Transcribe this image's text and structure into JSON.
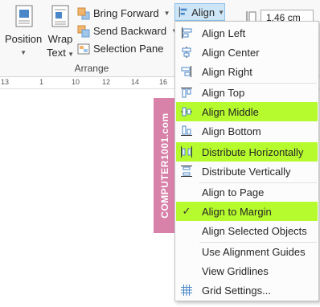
{
  "ribbon": {
    "position_label": "Position",
    "wrap_text_label_1": "Wrap",
    "wrap_text_label_2": "Text",
    "bring_forward_label": "Bring Forward",
    "send_backward_label": "Send Backward",
    "selection_pane_label": "Selection Pane",
    "arrange_group_label": "Arrange",
    "align_label": "Align",
    "width_value": "1.46 cm"
  },
  "ruler": {
    "ticks": [
      "13",
      "1",
      "10",
      "12",
      "14",
      "16"
    ]
  },
  "shape_text": "COMPUTER1001.com",
  "menu": {
    "items": [
      {
        "label": "Align Left",
        "icon": "align-left-icon",
        "highlighted": false,
        "checked": false
      },
      {
        "label": "Align Center",
        "icon": "align-center-icon",
        "highlighted": false,
        "checked": false
      },
      {
        "label": "Align Right",
        "icon": "align-right-icon",
        "highlighted": false,
        "checked": false
      },
      {
        "label": "Align Top",
        "icon": "align-top-icon",
        "highlighted": false,
        "checked": false
      },
      {
        "label": "Align Middle",
        "icon": "align-middle-icon",
        "highlighted": true,
        "checked": false
      },
      {
        "label": "Align Bottom",
        "icon": "align-bottom-icon",
        "highlighted": false,
        "checked": false
      },
      {
        "label": "Distribute Horizontally",
        "icon": "distribute-horizontally-icon",
        "highlighted": true,
        "checked": false
      },
      {
        "label": "Distribute Vertically",
        "icon": "distribute-vertically-icon",
        "highlighted": false,
        "checked": false
      },
      {
        "label": "Align to Page",
        "icon": "",
        "highlighted": false,
        "checked": false
      },
      {
        "label": "Align to Margin",
        "icon": "checkmark-icon",
        "highlighted": true,
        "checked": true
      },
      {
        "label": "Align Selected Objects",
        "icon": "",
        "highlighted": false,
        "checked": false
      },
      {
        "label": "Use Alignment Guides",
        "icon": "",
        "highlighted": false,
        "checked": false
      },
      {
        "label": "View Gridlines",
        "icon": "",
        "highlighted": false,
        "checked": false
      },
      {
        "label": "Grid Settings...",
        "icon": "grid-icon",
        "highlighted": false,
        "checked": false
      }
    ]
  },
  "colors": {
    "highlight": "#b6fb2d",
    "shape_fill": "#d881a9",
    "align_button_bg": "#cde6f7"
  }
}
